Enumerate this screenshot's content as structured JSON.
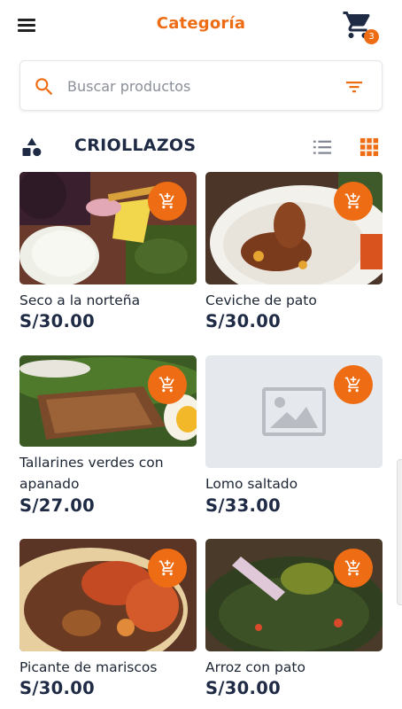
{
  "header": {
    "title": "Categoría",
    "cart_count": "3"
  },
  "search": {
    "placeholder": "Buscar productos",
    "value": ""
  },
  "section": {
    "title": "CRIOLLAZOS"
  },
  "colors": {
    "accent": "#ee6d14",
    "title_text": "#1f2b45",
    "placeholder_bg": "#e5e9ee"
  },
  "products": [
    {
      "name": "Seco a la norteña",
      "price": "S/30.00",
      "image": "food-photo-seco"
    },
    {
      "name": "Ceviche de pato",
      "price": "S/30.00",
      "image": "food-photo-duck"
    },
    {
      "name": "Tallarines verdes con apanado",
      "price": "S/27.00",
      "image": "food-photo-tallarines"
    },
    {
      "name": "Lomo saltado",
      "price": "S/33.00",
      "image": "image-placeholder-icon"
    },
    {
      "name": "Picante de mariscos",
      "price": "S/30.00",
      "image": "food-photo-picante"
    },
    {
      "name": "Arroz con pato",
      "price": "S/30.00",
      "image": "food-photo-arroz"
    }
  ]
}
